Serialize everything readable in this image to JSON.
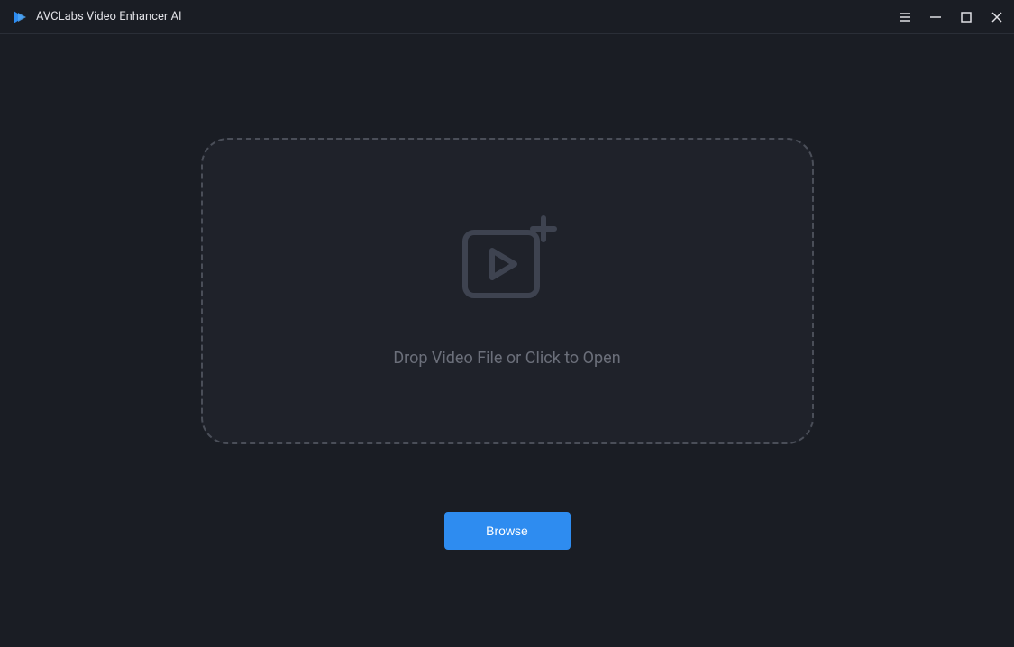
{
  "app": {
    "title": "AVCLabs Video Enhancer AI"
  },
  "dropZone": {
    "label": "Drop Video File or Click to Open"
  },
  "buttons": {
    "browse": "Browse"
  }
}
